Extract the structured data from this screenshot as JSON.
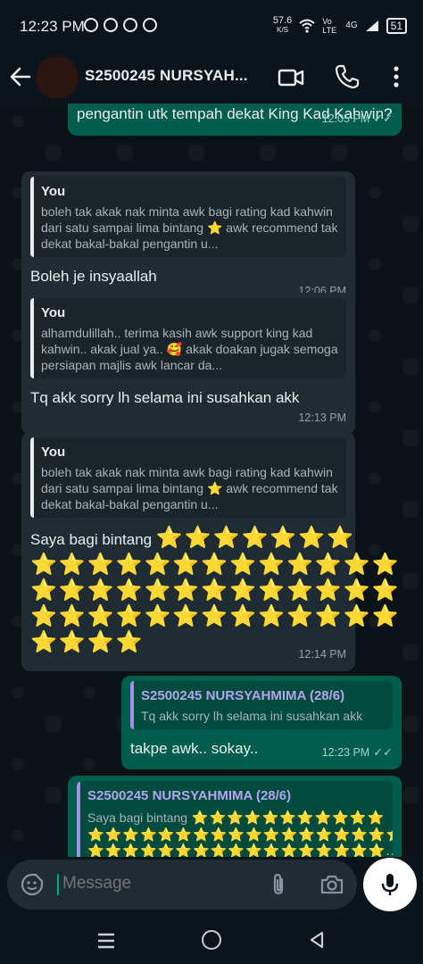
{
  "status_bar": {
    "time": "12:23 PM",
    "net_speed": "57.6",
    "net_unit": "K/S",
    "volte": "Vo LTE",
    "network": "4G",
    "battery": "51"
  },
  "header": {
    "title": "S2500245 NURSYAH..."
  },
  "messages": [
    {
      "text": "pengantin utk tempah dekat King Kad Kahwin?",
      "time": "12:05 PM"
    },
    {
      "quote_name": "You",
      "quote_text": "boleh tak akak nak minta awk bagi rating kad kahwin dari satu sampai lima bintang ⭐  awk recommend tak dekat bakal-bakal pengantin u...",
      "text": "Boleh je insyaallah",
      "time": "12:06 PM"
    },
    {
      "quote_name": "You",
      "quote_text": "alhamdulillah.. terima kasih awk support king kad kahwin.. akak jual ya.. 🥰 akak doakan jugak semoga persiapan majlis awk lancar da...",
      "text": "Tq akk sorry lh selama ini susahkan akk",
      "time": "12:13 PM"
    },
    {
      "quote_name": "You",
      "quote_text": "boleh tak akak nak minta awk bagi rating kad kahwin dari satu sampai lima bintang ⭐  awk recommend tak dekat bakal-bakal pengantin u...",
      "text": "Saya bagi bintang",
      "stars_line1": "⭐⭐⭐⭐⭐⭐⭐",
      "stars_rows": [
        "⭐⭐⭐⭐⭐⭐⭐⭐⭐⭐⭐⭐⭐",
        "⭐⭐⭐⭐⭐⭐⭐⭐⭐⭐⭐⭐⭐",
        "⭐⭐⭐⭐⭐⭐⭐⭐⭐⭐⭐⭐⭐",
        "⭐⭐⭐⭐"
      ],
      "time": "12:14 PM"
    },
    {
      "quote_name": "S2500245 NURSYAHMIMA (28/6)",
      "quote_text": "Tq akk sorry lh selama ini susahkan akk",
      "text": "takpe awk.. sokay..",
      "time": "12:23 PM"
    },
    {
      "quote_name": "S2500245 NURSYAHMIMA (28/6)",
      "quote_text": "Saya bagi bintang",
      "quote_stars1": "⭐⭐⭐⭐⭐⭐⭐⭐⭐⭐⭐",
      "quote_stars2": "⭐⭐⭐⭐⭐⭐⭐⭐⭐⭐⭐⭐⭐⭐⭐⭐⭐⭐",
      "quote_stars3": "⭐⭐⭐⭐⭐⭐⭐⭐⭐⭐⭐⭐⭐⭐⭐⭐⭐..."
    }
  ],
  "composer": {
    "placeholder": "Message"
  },
  "icons": [
    "back-icon",
    "video-call-icon",
    "voice-call-icon",
    "more-options-icon",
    "emoji-icon",
    "attach-icon",
    "camera-icon",
    "mic-icon"
  ]
}
